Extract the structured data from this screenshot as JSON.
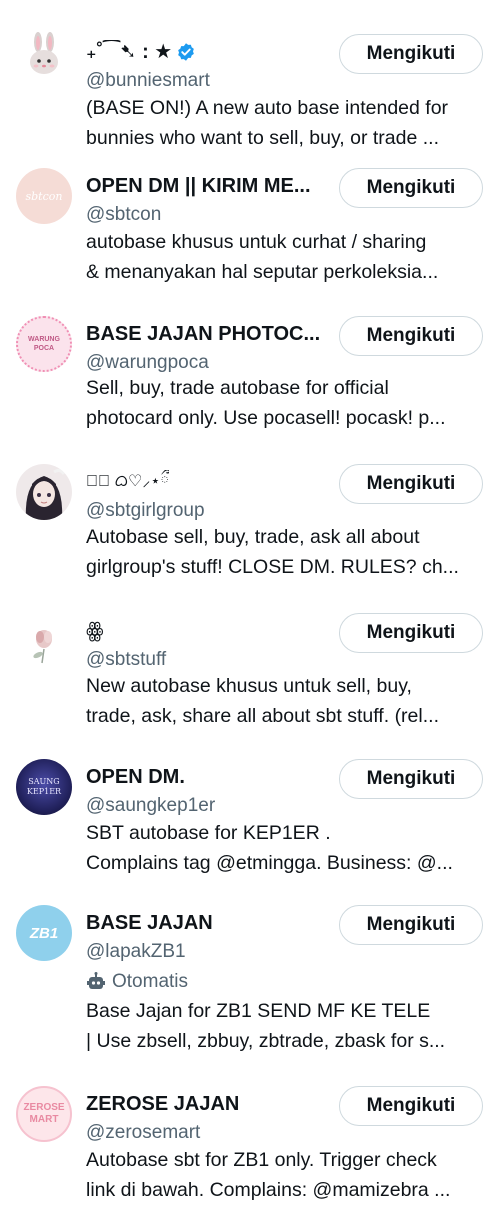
{
  "accounts": [
    {
      "name": "₊˚⁀➷ : ★",
      "verified": true,
      "handle": "@bunniesmart",
      "bio_lines": [
        "(BASE ON!) A new auto base intended for",
        "bunnies who want to sell, buy, or trade ..."
      ],
      "button": "Mengikuti"
    },
    {
      "name": "OPEN DM || KIRIM ME...",
      "handle": "@sbtcon",
      "avatar_text": "sbtcon",
      "bio_lines": [
        "autobase khusus untuk curhat / sharing",
        "& menanyakan hal seputar perkoleksia..."
      ],
      "button": "Mengikuti"
    },
    {
      "name": "BASE JAJAN PHOTOC...",
      "handle": "@warungpoca",
      "avatar_text": "WARUNG POCA",
      "bio_lines": [
        "Sell, buy, trade autobase for official",
        "photocard only. Use pocasell! pocask! p..."
      ],
      "button": "Mengikuti"
    },
    {
      "name": "⋆ི ᜊ♡⸝⋆ྀ",
      "handle": "@sbtgirlgroup",
      "bio_lines": [
        "Autobase sell, buy, trade, ask all about",
        "girlgroup's stuff! CLOSE DM. RULES? ch..."
      ],
      "button": "Mengikuti"
    },
    {
      "name": "ꙮ",
      "handle": "@sbtstuff",
      "bio_lines": [
        "New autobase khusus untuk sell, buy,",
        "trade, ask, share all about sbt stuff. (rel..."
      ],
      "button": "Mengikuti"
    },
    {
      "name": "OPEN DM.",
      "handle": "@saungkep1er",
      "avatar_text": "SAUNG KEP1ER",
      "bio_lines": [
        "SBT autobase for KEP1ER .",
        "Complains tag @etmingga. Business: @..."
      ],
      "button": "Mengikuti"
    },
    {
      "name": "BASE JAJAN",
      "handle": "@lapakZB1",
      "automated_label": "Otomatis",
      "avatar_text": "ZB1",
      "bio_lines": [
        "Base Jajan for ZB1 SEND MF KE TELE",
        "| Use zbsell, zbbuy, zbtrade, zbask for s..."
      ],
      "button": "Mengikuti"
    },
    {
      "name": "ZEROSE JAJAN",
      "handle": "@zerosemart",
      "avatar_text": "ZEROSE MART",
      "bio_lines": [
        "Autobase sbt for ZB1 only. Trigger check",
        "link di bawah. Complains: @mamizebra ..."
      ],
      "button": "Mengikuti"
    }
  ],
  "colors": {
    "text": "#0f1419",
    "secondary": "#536471",
    "border": "#cfd9de",
    "verified": "#1d9bf0"
  }
}
